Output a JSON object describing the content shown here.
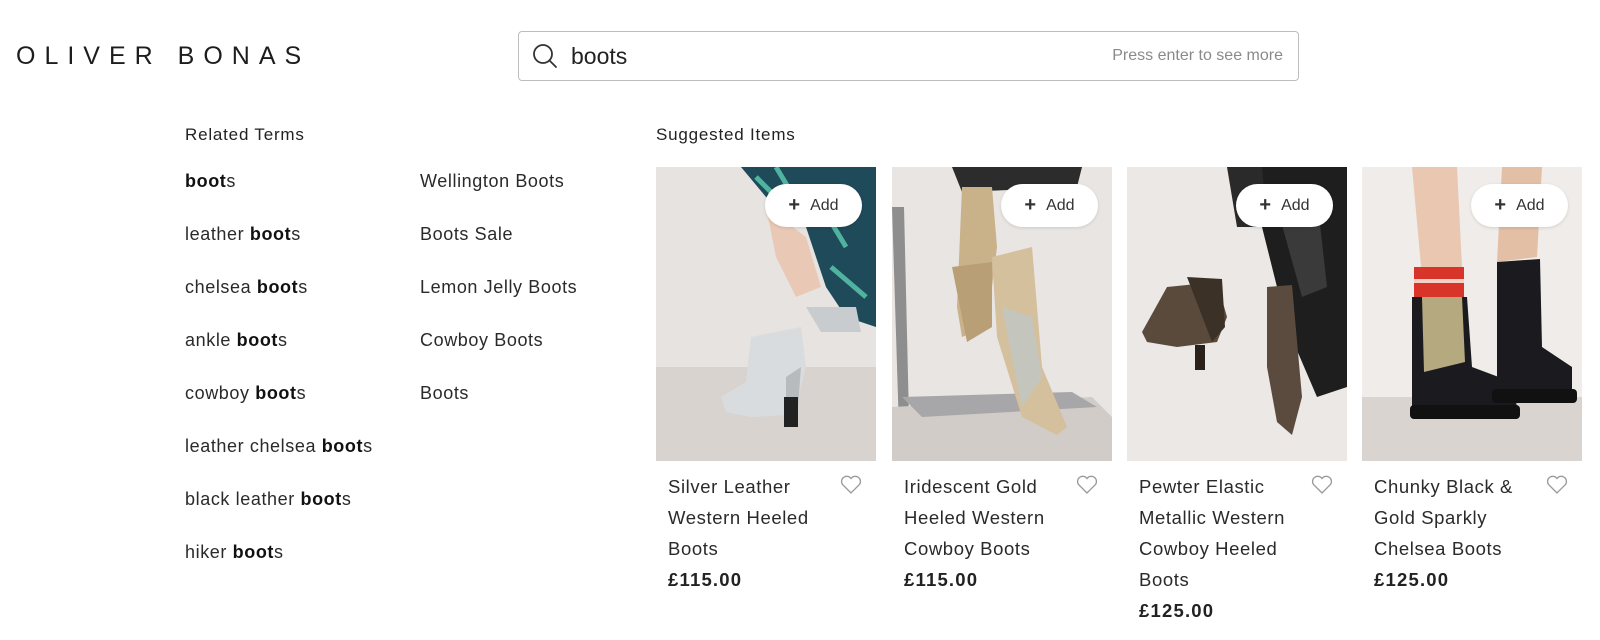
{
  "header": {
    "logo": "OLIVER BONAS"
  },
  "search": {
    "value": "boots",
    "hint": "Press enter to see more"
  },
  "related": {
    "heading": "Related Terms",
    "col1": [
      {
        "prefix": "",
        "match": "boot",
        "suffix": "s"
      },
      {
        "prefix": "leather ",
        "match": "boot",
        "suffix": "s"
      },
      {
        "prefix": "chelsea ",
        "match": "boot",
        "suffix": "s"
      },
      {
        "prefix": "ankle ",
        "match": "boot",
        "suffix": "s"
      },
      {
        "prefix": "cowboy ",
        "match": "boot",
        "suffix": "s"
      },
      {
        "prefix": "leather chelsea ",
        "match": "boot",
        "suffix": "s"
      },
      {
        "prefix": "black leather ",
        "match": "boot",
        "suffix": "s"
      },
      {
        "prefix": "hiker ",
        "match": "boot",
        "suffix": "s"
      }
    ],
    "col2": [
      "Wellington Boots",
      "Boots Sale",
      "Lemon Jelly Boots",
      "Cowboy Boots",
      "Boots"
    ]
  },
  "suggested": {
    "heading": "Suggested Items",
    "add_label": "Add",
    "products": [
      {
        "name": "Silver Leather Western Heeled Boots",
        "price": "£115.00"
      },
      {
        "name": "Iridescent Gold Heeled Western Cowboy Boots",
        "price": "£115.00"
      },
      {
        "name": "Pewter Elastic Metallic Western Cowboy Heeled Boots",
        "price": "£125.00"
      },
      {
        "name": "Chunky Black & Gold Sparkly Chelsea Boots",
        "price": "£125.00"
      }
    ]
  },
  "icons": {
    "search": "search-icon",
    "heart": "heart-icon",
    "plus": "plus-icon"
  }
}
